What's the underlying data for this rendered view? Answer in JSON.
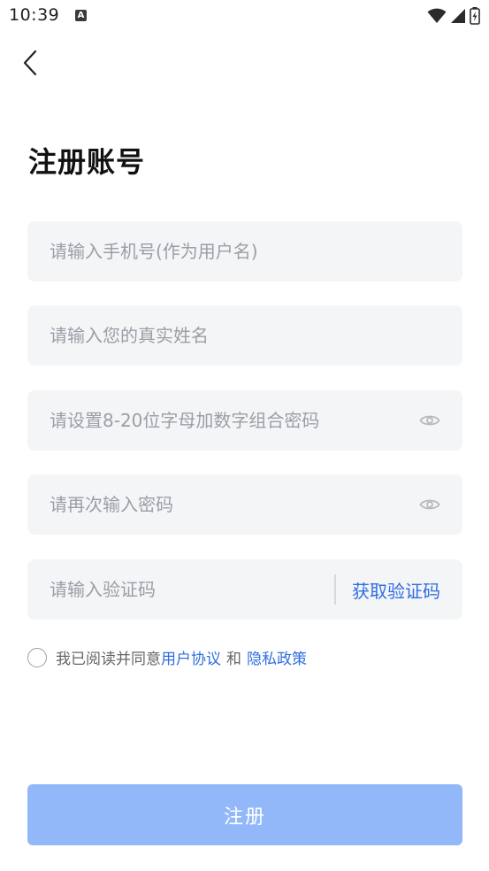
{
  "status_bar": {
    "time": "10:39",
    "notification_badge": "A"
  },
  "header": {
    "title": "注册账号"
  },
  "form": {
    "phone_placeholder": "请输入手机号(作为用户名)",
    "name_placeholder": "请输入您的真实姓名",
    "password_placeholder": "请设置8-20位字母加数字组合密码",
    "confirm_password_placeholder": "请再次输入密码",
    "code_placeholder": "请输入验证码",
    "get_code_label": "获取验证码"
  },
  "agreement": {
    "prefix": "我已阅读并同意",
    "user_agreement": "用户协议",
    "and": "和",
    "privacy_policy": "隐私政策"
  },
  "submit_label": "注册",
  "colors": {
    "accent": "#2f6ee0",
    "submit_disabled": "#93b8f9",
    "field_bg": "#f4f5f7"
  }
}
